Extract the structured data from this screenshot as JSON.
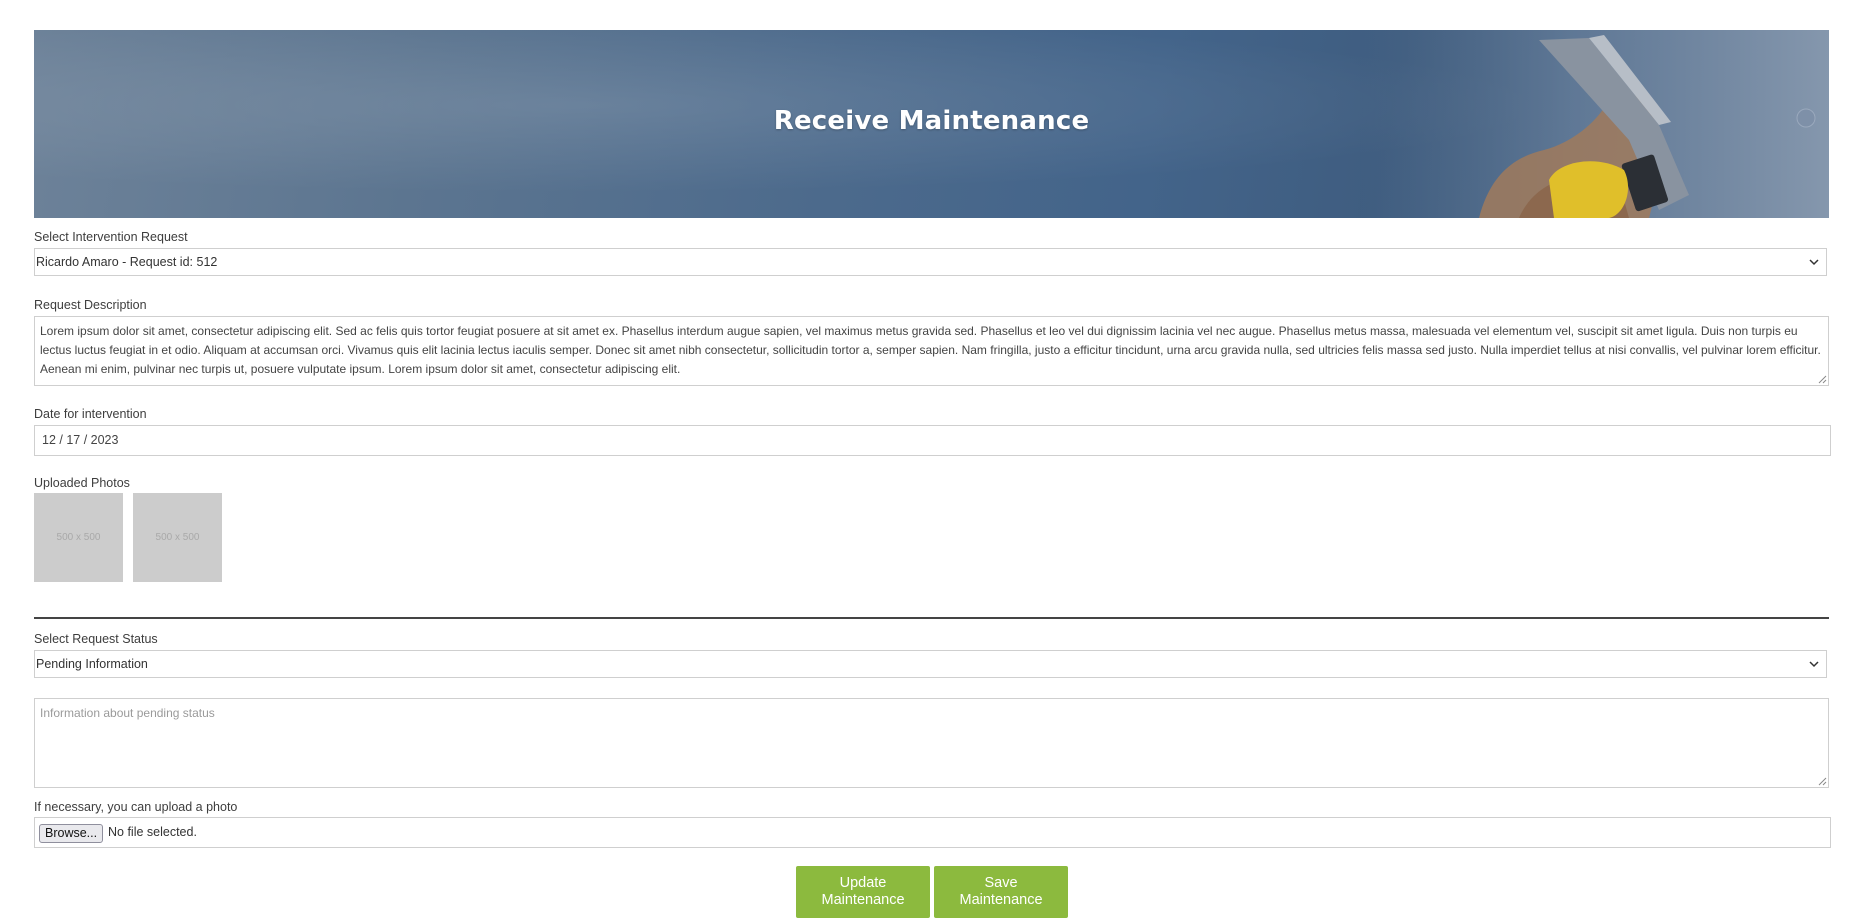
{
  "header": {
    "title": "Receive Maintenance"
  },
  "request_select": {
    "label": "Select Intervention Request",
    "value": "Ricardo Amaro - Request id: 512"
  },
  "description": {
    "label": "Request Description",
    "value": "Lorem ipsum dolor sit amet, consectetur adipiscing elit. Sed ac felis quis tortor feugiat posuere at sit amet ex. Phasellus interdum augue sapien, vel maximus metus gravida sed. Phasellus et leo vel dui dignissim lacinia vel nec augue. Phasellus metus massa, malesuada vel elementum vel, suscipit sit amet ligula. Duis non turpis eu lectus luctus feugiat in et odio. Aliquam at accumsan orci. Vivamus quis elit lacinia lectus iaculis semper. Donec sit amet nibh consectetur, sollicitudin tortor a, semper sapien. Nam fringilla, justo a efficitur tincidunt, urna arcu gravida nulla, sed ultricies felis massa sed justo. Nulla imperdiet tellus at nisi convallis, vel pulvinar lorem efficitur. Aenean mi enim, pulvinar nec turpis ut, posuere vulputate ipsum. Lorem ipsum dolor sit amet, consectetur adipiscing elit."
  },
  "date": {
    "label": "Date for intervention",
    "value": "12 / 17 / 2023"
  },
  "photos": {
    "label": "Uploaded Photos",
    "items": [
      "500 x 500",
      "500 x 500"
    ]
  },
  "status_select": {
    "label": "Select Request Status",
    "value": "Pending Information"
  },
  "pending_info": {
    "placeholder": "Information about pending status"
  },
  "upload": {
    "label": "If necessary, you can upload a photo",
    "browse_label": "Browse...",
    "status": "No file selected."
  },
  "actions": {
    "update_line1": "Update",
    "update_line2": "Maintenance",
    "save_line1": "Save",
    "save_line2": "Maintenance"
  },
  "colors": {
    "accent": "#8cba3e",
    "hero_blue": "#43648a"
  }
}
